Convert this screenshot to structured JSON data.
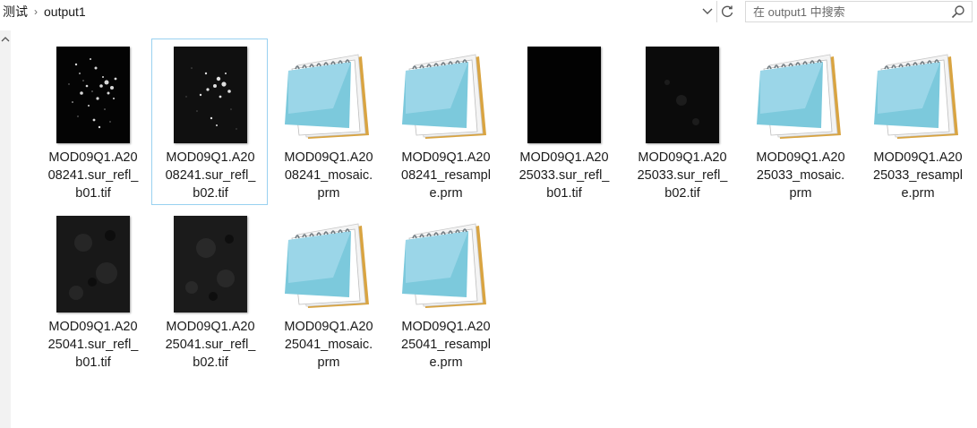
{
  "breadcrumb": {
    "items": [
      "测试",
      "output1"
    ],
    "separator": "›"
  },
  "search": {
    "placeholder": "在 output1 中搜索"
  },
  "files": [
    {
      "name": "MOD09Q1.A2008241.sur_refl_b01.tif",
      "line1": "MOD09Q1.A20",
      "line2": "08241.sur_refl_",
      "line3": "b01.tif",
      "type": "tif",
      "thumb": "bright-a",
      "selected": false
    },
    {
      "name": "MOD09Q1.A2008241.sur_refl_b02.tif",
      "line1": "MOD09Q1.A20",
      "line2": "08241.sur_refl_",
      "line3": "b02.tif",
      "type": "tif",
      "thumb": "bright-b",
      "selected": true
    },
    {
      "name": "MOD09Q1.A2008241_mosaic.prm",
      "line1": "MOD09Q1.A20",
      "line2": "08241_mosaic.",
      "line3": "prm",
      "type": "prm",
      "thumb": "notepad-icon",
      "selected": false
    },
    {
      "name": "MOD09Q1.A2008241_resample.prm",
      "line1": "MOD09Q1.A20",
      "line2": "08241_resampl",
      "line3": "e.prm",
      "type": "prm",
      "thumb": "notepad-icon",
      "selected": false
    },
    {
      "name": "MOD09Q1.A2025033.sur_refl_b01.tif",
      "line1": "MOD09Q1.A20",
      "line2": "25033.sur_refl_",
      "line3": "b01.tif",
      "type": "tif",
      "thumb": "dark",
      "selected": false
    },
    {
      "name": "MOD09Q1.A2025033.sur_refl_b02.tif",
      "line1": "MOD09Q1.A20",
      "line2": "25033.sur_refl_",
      "line3": "b02.tif",
      "type": "tif",
      "thumb": "dark-2",
      "selected": false
    },
    {
      "name": "MOD09Q1.A2025033_mosaic.prm",
      "line1": "MOD09Q1.A20",
      "line2": "25033_mosaic.",
      "line3": "prm",
      "type": "prm",
      "thumb": "notepad-icon",
      "selected": false
    },
    {
      "name": "MOD09Q1.A2025033_resample.prm",
      "line1": "MOD09Q1.A20",
      "line2": "25033_resampl",
      "line3": "e.prm",
      "type": "prm",
      "thumb": "notepad-icon",
      "selected": false
    },
    {
      "name": "MOD09Q1.A2025041.sur_refl_b01.tif",
      "line1": "MOD09Q1.A20",
      "line2": "25041.sur_refl_",
      "line3": "b01.tif",
      "type": "tif",
      "thumb": "gray",
      "selected": false
    },
    {
      "name": "MOD09Q1.A2025041.sur_refl_b02.tif",
      "line1": "MOD09Q1.A20",
      "line2": "25041.sur_refl_",
      "line3": "b02.tif",
      "type": "tif",
      "thumb": "gray-2",
      "selected": false
    },
    {
      "name": "MOD09Q1.A2025041_mosaic.prm",
      "line1": "MOD09Q1.A20",
      "line2": "25041_mosaic.",
      "line3": "prm",
      "type": "prm",
      "thumb": "notepad-icon",
      "selected": false
    },
    {
      "name": "MOD09Q1.A2025041_resample.prm",
      "line1": "MOD09Q1.A20",
      "line2": "25041_resampl",
      "line3": "e.prm",
      "type": "prm",
      "thumb": "notepad-icon",
      "selected": false
    }
  ],
  "colors": {
    "selection_border": "#99d1f0",
    "text": "#1a1a1a"
  }
}
